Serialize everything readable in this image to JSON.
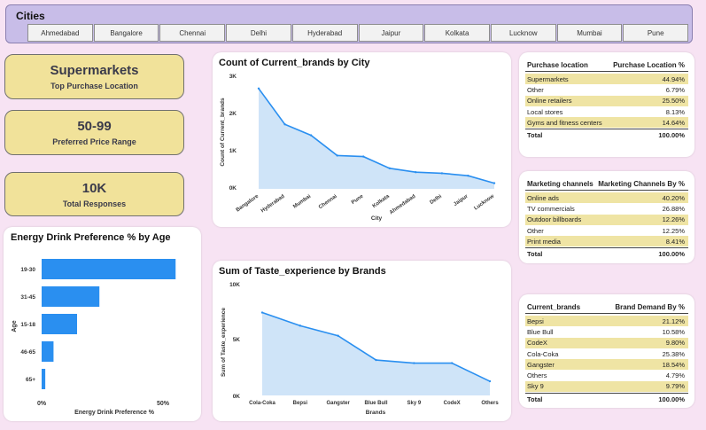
{
  "slicer": {
    "title": "Cities",
    "cities": [
      "Ahmedabad",
      "Bangalore",
      "Chennai",
      "Delhi",
      "Hyderabad",
      "Jaipur",
      "Kolkata",
      "Lucknow",
      "Mumbai",
      "Pune"
    ]
  },
  "kpis": [
    {
      "value": "Supermarkets",
      "label": "Top Purchase Location"
    },
    {
      "value": "50-99",
      "label": "Preferred Price Range"
    },
    {
      "value": "10K",
      "label": "Total Responses"
    }
  ],
  "colors": {
    "accent": "#2a8ff0",
    "area_fill": "#cfe4f8",
    "highlight_row": "#efe4a4",
    "kpi_bg": "#f1e29a",
    "slicer_bg": "#c8bde8"
  },
  "age_chart": {
    "title": "Energy Drink Preference % by Age",
    "xlabel": "Energy Drink Preference %",
    "ylabel": "Age",
    "x_ticks": [
      "0%",
      "50%"
    ]
  },
  "city_chart": {
    "title": "Count of Current_brands by City",
    "xlabel": "City",
    "ylabel": "Count of Current_brands",
    "y_ticks": [
      "0K",
      "1K",
      "2K",
      "3K"
    ]
  },
  "taste_chart": {
    "title": "Sum of Taste_experience by Brands",
    "xlabel": "Brands",
    "ylabel": "Sum of Taste_experience",
    "y_ticks": [
      "0K",
      "5K",
      "10K"
    ]
  },
  "chart_data": [
    {
      "type": "bar",
      "orientation": "horizontal",
      "title": "Energy Drink Preference % by Age",
      "xlabel": "Energy Drink Preference %",
      "ylabel": "Age",
      "categories": [
        "19-30",
        "31-45",
        "15-18",
        "46-65",
        "65+"
      ],
      "values": [
        55.2,
        23.8,
        14.6,
        4.9,
        1.5
      ],
      "xlim": [
        0,
        60
      ],
      "grid": false
    },
    {
      "type": "area",
      "title": "Count of Current_brands by City",
      "xlabel": "City",
      "ylabel": "Count of Current_brands",
      "categories": [
        "Bangalore",
        "Hyderabad",
        "Mumbai",
        "Chennai",
        "Pune",
        "Kolkata",
        "Ahmedabad",
        "Delhi",
        "Jaipur",
        "Lucknow"
      ],
      "values": [
        2830,
        1820,
        1510,
        940,
        910,
        580,
        470,
        440,
        370,
        160
      ],
      "ylim": [
        0,
        3000
      ],
      "grid": false
    },
    {
      "type": "area",
      "title": "Sum of Taste_experience by Brands",
      "xlabel": "Brands",
      "ylabel": "Sum of Taste_experience",
      "categories": [
        "Cola-Coka",
        "Bepsi",
        "Gangster",
        "Blue Bull",
        "Sky 9",
        "CodeX",
        "Others"
      ],
      "values": [
        8200,
        6900,
        5900,
        3500,
        3200,
        3200,
        1400
      ],
      "ylim": [
        0,
        10000
      ],
      "grid": false
    }
  ],
  "tables": {
    "purchase": {
      "headers": [
        "Purchase location",
        "Purchase Location %"
      ],
      "rows": [
        [
          "Supermarkets",
          "44.94%"
        ],
        [
          "Other",
          "6.79%"
        ],
        [
          "Online retailers",
          "25.50%"
        ],
        [
          "Local stores",
          "8.13%"
        ],
        [
          "Gyms and fitness centers",
          "14.64%"
        ]
      ],
      "total": [
        "Total",
        "100.00%"
      ]
    },
    "marketing": {
      "headers": [
        "Marketing channels",
        "Marketing Channels By %"
      ],
      "rows": [
        [
          "Online ads",
          "40.20%"
        ],
        [
          "TV commercials",
          "26.88%"
        ],
        [
          "Outdoor billboards",
          "12.26%"
        ],
        [
          "Other",
          "12.25%"
        ],
        [
          "Print media",
          "8.41%"
        ]
      ],
      "total": [
        "Total",
        "100.00%"
      ]
    },
    "brands": {
      "headers": [
        "Current_brands",
        "Brand Demand By %"
      ],
      "rows": [
        [
          "Bepsi",
          "21.12%"
        ],
        [
          "Blue Bull",
          "10.58%"
        ],
        [
          "CodeX",
          "9.80%"
        ],
        [
          "Cola-Coka",
          "25.38%"
        ],
        [
          "Gangster",
          "18.54%"
        ],
        [
          "Others",
          "4.79%"
        ],
        [
          "Sky 9",
          "9.79%"
        ]
      ],
      "total": [
        "Total",
        "100.00%"
      ]
    }
  }
}
